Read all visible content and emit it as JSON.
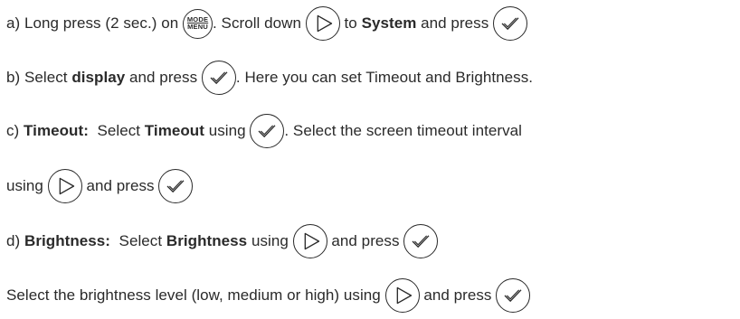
{
  "steps": {
    "a": {
      "prefix": "a) Long press (2 sec.) on ",
      "mid": ". Scroll down ",
      "to": " to ",
      "bold": "System",
      "end": " and press "
    },
    "b": {
      "prefix": "b) Select ",
      "bold": "display",
      "mid": " and press ",
      "end": ". Here you can set Timeout and Brightness."
    },
    "c": {
      "prefix": "c) ",
      "bold1": "Timeout:",
      "mid1": "  Select ",
      "bold2": "Timeout",
      "mid2": " using ",
      "end": ". Select the screen timeout interval",
      "cont_prefix": "using ",
      "cont_mid": " and press "
    },
    "d": {
      "prefix": "d) ",
      "bold1": "Brightness:",
      "mid1": "  Select ",
      "bold2": "Brightness",
      "mid2": " using ",
      "mid3": " and press "
    },
    "e": {
      "prefix": "Select the brightness level (low, medium or high) using ",
      "mid": " and press "
    }
  },
  "icons": {
    "mode_menu": {
      "name": "mode-menu-icon",
      "top": "MODE",
      "bottom": "MENU"
    },
    "scroll": {
      "name": "play-icon"
    },
    "confirm": {
      "name": "checkmark-icon"
    }
  }
}
